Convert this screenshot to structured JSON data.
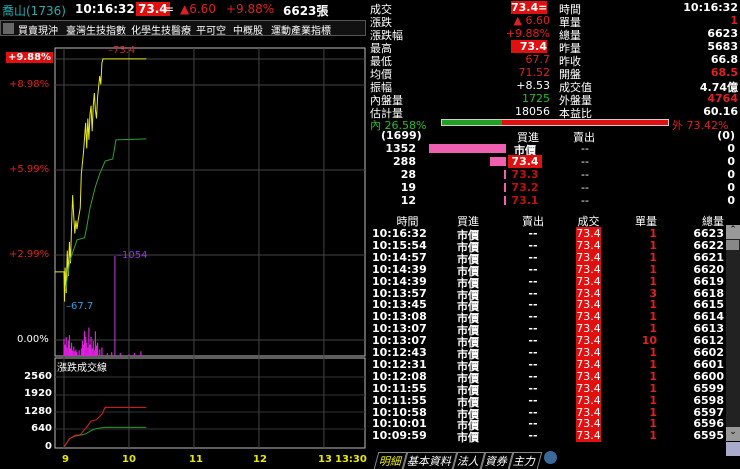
{
  "header": {
    "stock": "喬山(1736)",
    "time": "10:16:32",
    "price": "73.4",
    "flat_mark": "=",
    "change": "▲6.60",
    "pct": "+9.88%",
    "volume": "6623張"
  },
  "toolbar": {
    "items": [
      "買賣現沖",
      "臺灣生技指數",
      "化學生技醫療",
      "平可空",
      "中概股",
      "運動產業指標"
    ]
  },
  "chart": {
    "y_labels": [
      "+9.88%",
      "+8.98%",
      "+5.99%",
      "+2.99%",
      "0.00%"
    ],
    "high_label": "73.4",
    "low_label": "67.7",
    "vol_peak_label": "1054",
    "lower_title": "漲跌成交線",
    "lower_y_labels": [
      "2560",
      "1920",
      "1280",
      "640",
      "0"
    ],
    "x_labels": [
      "9",
      "10",
      "11",
      "12",
      "13",
      "13:30"
    ]
  },
  "chart_data": {
    "type": "line",
    "ref_price": 66.8,
    "limit_up": 73.4,
    "x_unit": "minutes since 9:00",
    "xlim": [
      0,
      270
    ],
    "price": [
      [
        0,
        68.4
      ],
      [
        0.5,
        67.7
      ],
      [
        1,
        68.5
      ],
      [
        2,
        67.9
      ],
      [
        3,
        68.9
      ],
      [
        4,
        68.3
      ],
      [
        5,
        69.1
      ],
      [
        6,
        68.6
      ],
      [
        7,
        69.5
      ],
      [
        8,
        70.2
      ],
      [
        9,
        69.7
      ],
      [
        10,
        69.3
      ],
      [
        11,
        69.6
      ],
      [
        12,
        69.4
      ],
      [
        13,
        69.6
      ],
      [
        15,
        69.9
      ],
      [
        16,
        70.7
      ],
      [
        18,
        71.2
      ],
      [
        20,
        71.9
      ],
      [
        21,
        71.3
      ],
      [
        22,
        72.0
      ],
      [
        23,
        71.5
      ],
      [
        24,
        72.1
      ],
      [
        25,
        72.3
      ],
      [
        26,
        71.7
      ],
      [
        27,
        72.3
      ],
      [
        28,
        72.6
      ],
      [
        29,
        72.2
      ],
      [
        30,
        72.0
      ],
      [
        31,
        72.5
      ],
      [
        33,
        73.0
      ],
      [
        34,
        72.8
      ],
      [
        35,
        73.3
      ],
      [
        36,
        73.4
      ],
      [
        76,
        73.4
      ]
    ],
    "avg_price": [
      [
        1.5,
        68.0
      ],
      [
        5.5,
        68.67
      ],
      [
        12,
        69.15
      ],
      [
        19,
        69.2
      ],
      [
        21,
        69.45
      ],
      [
        24,
        69.9
      ],
      [
        29,
        70.4
      ],
      [
        33,
        70.7
      ],
      [
        38,
        71.0
      ],
      [
        45,
        71.05
      ],
      [
        48,
        71.5
      ],
      [
        76,
        71.52
      ]
    ],
    "volume": [
      [
        0,
        180
      ],
      [
        1,
        120
      ],
      [
        2,
        200
      ],
      [
        3,
        90
      ],
      [
        4,
        160
      ],
      [
        5,
        220
      ],
      [
        6,
        80
      ],
      [
        7,
        140
      ],
      [
        8,
        60
      ],
      [
        9,
        100
      ],
      [
        10,
        50
      ],
      [
        11,
        70
      ],
      [
        12,
        40
      ],
      [
        14,
        60
      ],
      [
        16,
        80
      ],
      [
        17,
        160
      ],
      [
        18,
        120
      ],
      [
        19,
        260
      ],
      [
        20,
        200
      ],
      [
        21,
        140
      ],
      [
        22,
        90
      ],
      [
        23,
        300
      ],
      [
        24,
        120
      ],
      [
        25,
        200
      ],
      [
        26,
        80
      ],
      [
        27,
        160
      ],
      [
        28,
        60
      ],
      [
        29,
        260
      ],
      [
        30,
        110
      ],
      [
        31,
        140
      ],
      [
        33,
        70
      ],
      [
        35,
        90
      ],
      [
        40,
        30
      ],
      [
        44,
        40
      ],
      [
        47,
        1054
      ],
      [
        52,
        30
      ],
      [
        60,
        20
      ],
      [
        65,
        30
      ],
      [
        71,
        50
      ]
    ],
    "vol_max": 1054,
    "cum_outer": [
      [
        0,
        0
      ],
      [
        5,
        300
      ],
      [
        10,
        420
      ],
      [
        15,
        450
      ],
      [
        20,
        680
      ],
      [
        25,
        950
      ],
      [
        30,
        1000
      ],
      [
        35,
        1200
      ],
      [
        38,
        1450
      ],
      [
        76,
        1450
      ]
    ],
    "cum_inner": [
      [
        0,
        0
      ],
      [
        5,
        300
      ],
      [
        10,
        400
      ],
      [
        15,
        430
      ],
      [
        20,
        480
      ],
      [
        25,
        600
      ],
      [
        30,
        680
      ],
      [
        38,
        720
      ],
      [
        76,
        720
      ]
    ],
    "lower_ylim": [
      0,
      2560
    ]
  },
  "quote": {
    "left": [
      [
        "成交",
        "73.4="
      ],
      [
        "漲跌",
        "▲ 6.60"
      ],
      [
        "漲跌幅",
        "+9.88%"
      ],
      [
        "最高",
        "73.4"
      ],
      [
        "最低",
        "67.7"
      ],
      [
        "均價",
        "71.52"
      ],
      [
        "振幅",
        "+8.53"
      ],
      [
        "內盤量",
        "1725"
      ],
      [
        "估計量",
        "18056"
      ]
    ],
    "right": [
      [
        "時間",
        "10:16:32"
      ],
      [
        "單量",
        "1"
      ],
      [
        "總量",
        "6623"
      ],
      [
        "昨量",
        "5683"
      ],
      [
        "昨收",
        "66.8"
      ],
      [
        "開盤",
        "68.5"
      ],
      [
        "成交值",
        "4.74億"
      ],
      [
        "外盤量",
        "4764"
      ],
      [
        "本益比",
        "60.16"
      ]
    ],
    "inner_label": "內 26.58%",
    "outer_label": "外 73.42%",
    "inner_ratio": 0.2658
  },
  "book": {
    "buy_total": "(1699)",
    "buy_hdr": "買進",
    "sell_hdr": "賣出",
    "sell_total": "(0)",
    "rows": [
      {
        "qty": "1352",
        "price": "市價",
        "sell": "--",
        "sq": "0",
        "v": 1352
      },
      {
        "qty": "288",
        "price": "73.4",
        "sell": "--",
        "sq": "0",
        "v": 288
      },
      {
        "qty": "28",
        "price": "73.3",
        "sell": "--",
        "sq": "0",
        "v": 28
      },
      {
        "qty": "19",
        "price": "73.2",
        "sell": "--",
        "sq": "0",
        "v": 19
      },
      {
        "qty": "12",
        "price": "73.1",
        "sell": "--",
        "sq": "0",
        "v": 12
      }
    ]
  },
  "trades": {
    "headers": [
      "時間",
      "買進",
      "賣出",
      "成交",
      "單量",
      "總量"
    ],
    "rows": [
      [
        "10:16:32",
        "市價",
        "--",
        "73.4",
        "1",
        "6623"
      ],
      [
        "10:15:54",
        "市價",
        "--",
        "73.4",
        "1",
        "6622"
      ],
      [
        "10:14:57",
        "市價",
        "--",
        "73.4",
        "1",
        "6621"
      ],
      [
        "10:14:39",
        "市價",
        "--",
        "73.4",
        "1",
        "6620"
      ],
      [
        "10:14:39",
        "市價",
        "--",
        "73.4",
        "1",
        "6619"
      ],
      [
        "10:13:57",
        "市價",
        "--",
        "73.4",
        "3",
        "6618"
      ],
      [
        "10:13:45",
        "市價",
        "--",
        "73.4",
        "1",
        "6615"
      ],
      [
        "10:13:08",
        "市價",
        "--",
        "73.4",
        "1",
        "6614"
      ],
      [
        "10:13:07",
        "市價",
        "--",
        "73.4",
        "1",
        "6613"
      ],
      [
        "10:13:07",
        "市價",
        "--",
        "73.4",
        "10",
        "6612"
      ],
      [
        "10:12:43",
        "市價",
        "--",
        "73.4",
        "1",
        "6602"
      ],
      [
        "10:12:31",
        "市價",
        "--",
        "73.4",
        "1",
        "6601"
      ],
      [
        "10:12:08",
        "市價",
        "--",
        "73.4",
        "1",
        "6600"
      ],
      [
        "10:11:55",
        "市價",
        "--",
        "73.4",
        "1",
        "6599"
      ],
      [
        "10:11:55",
        "市價",
        "--",
        "73.4",
        "1",
        "6598"
      ],
      [
        "10:10:58",
        "市價",
        "--",
        "73.4",
        "1",
        "6597"
      ],
      [
        "10:10:01",
        "市價",
        "--",
        "73.4",
        "1",
        "6596"
      ],
      [
        "10:09:59",
        "市價",
        "--",
        "73.4",
        "1",
        "6595"
      ]
    ]
  },
  "tabs": [
    "明細",
    "基本資料",
    "法人",
    "資券",
    "主力"
  ]
}
